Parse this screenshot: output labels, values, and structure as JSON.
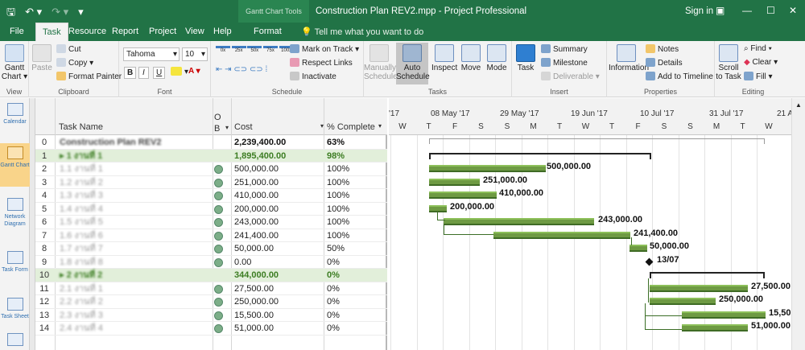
{
  "window": {
    "qat_icons": [
      "save-icon",
      "undo-icon",
      "redo-icon",
      "customize-icon"
    ],
    "tool_tab_context": "Gantt Chart Tools",
    "doc_title": "Construction Plan REV2.mpp  -  Project Professional",
    "signin": "Sign in",
    "controls": [
      "—",
      "☐",
      "✕"
    ]
  },
  "tabs": [
    "File",
    "Task",
    "Resource",
    "Report",
    "Project",
    "View",
    "Help",
    "Format"
  ],
  "active_tab": "Task",
  "tellme": "Tell me what you want to do",
  "ribbon": {
    "view": {
      "gantt_line1": "Gantt",
      "gantt_line2": "Chart ▾",
      "label": "View"
    },
    "clipboard": {
      "paste": "Paste",
      "cut": "Cut",
      "copy": "Copy ▾",
      "format_painter": "Format Painter",
      "label": "Clipboard"
    },
    "font": {
      "font_name": "Tahoma",
      "font_size": "10",
      "bold": "B",
      "italic": "I",
      "underline": "U",
      "label": "Font"
    },
    "schedule": {
      "pcts": [
        "0x",
        "25x",
        "50x",
        "75x",
        "100x"
      ],
      "mark_on_track": "Mark on Track",
      "respect_links": "Respect Links",
      "inactivate": "Inactivate",
      "label": "Schedule"
    },
    "tasks": {
      "manually": "Manually",
      "manually2": "Schedule",
      "auto": "Auto",
      "auto2": "Schedule",
      "inspect": "Inspect",
      "move": "Move",
      "mode": "Mode",
      "label": "Tasks"
    },
    "insert": {
      "task": "Task",
      "summary": "Summary",
      "milestone": "Milestone",
      "deliverable": "Deliverable",
      "label": "Insert"
    },
    "properties": {
      "information": "Information",
      "notes": "Notes",
      "details": "Details",
      "add_timeline": "Add to Timeline",
      "label": "Properties"
    },
    "editing": {
      "scroll": "Scroll",
      "scroll2": "to Task",
      "find": "Find ▾",
      "clear": "Clear ▾",
      "fill": "Fill ▾",
      "label": "Editing"
    }
  },
  "sidebar": [
    "Calendar",
    "Gantt Chart",
    "Network Diagram",
    "Task Form",
    "Task Sheet"
  ],
  "table": {
    "headers": {
      "task_name": "Task Name",
      "indicators_line1": "O",
      "indicators_line2": "B",
      "cost": "Cost",
      "pct": "% Complete"
    },
    "rows": [
      {
        "id": "0",
        "name": "Construction Plan REV2",
        "cost": "2,239,400.00",
        "pct": "63%",
        "kind": "proj",
        "ind": false
      },
      {
        "id": "1",
        "name": "▸ 1 งานที่ 1",
        "cost": "1,895,400.00",
        "pct": "98%",
        "kind": "summary",
        "ind": false
      },
      {
        "id": "2",
        "name": "1.1 งานที่ 1",
        "cost": "500,000.00",
        "pct": "100%",
        "kind": "task",
        "ind": true
      },
      {
        "id": "3",
        "name": "1.2 งานที่ 2",
        "cost": "251,000.00",
        "pct": "100%",
        "kind": "task",
        "ind": true
      },
      {
        "id": "4",
        "name": "1.3 งานที่ 3",
        "cost": "410,000.00",
        "pct": "100%",
        "kind": "task",
        "ind": true
      },
      {
        "id": "5",
        "name": "1.4 งานที่ 4",
        "cost": "200,000.00",
        "pct": "100%",
        "kind": "task",
        "ind": true
      },
      {
        "id": "6",
        "name": "1.5 งานที่ 5",
        "cost": "243,000.00",
        "pct": "100%",
        "kind": "task",
        "ind": true
      },
      {
        "id": "7",
        "name": "1.6 งานที่ 6",
        "cost": "241,400.00",
        "pct": "100%",
        "kind": "task",
        "ind": true
      },
      {
        "id": "8",
        "name": "1.7 งานที่ 7",
        "cost": "50,000.00",
        "pct": "50%",
        "kind": "task",
        "ind": true
      },
      {
        "id": "9",
        "name": "1.8 งานที่ 8",
        "cost": "0.00",
        "pct": "0%",
        "kind": "task",
        "ind": true
      },
      {
        "id": "10",
        "name": "▸ 2 งานที่ 2",
        "cost": "344,000.00",
        "pct": "0%",
        "kind": "summary",
        "ind": false
      },
      {
        "id": "11",
        "name": "2.1 งานที่ 1",
        "cost": "27,500.00",
        "pct": "0%",
        "kind": "task",
        "ind": true
      },
      {
        "id": "12",
        "name": "2.2 งานที่ 2",
        "cost": "250,000.00",
        "pct": "0%",
        "kind": "task",
        "ind": true
      },
      {
        "id": "13",
        "name": "2.3 งานที่ 3",
        "cost": "15,500.00",
        "pct": "0%",
        "kind": "task",
        "ind": true
      },
      {
        "id": "14",
        "name": "2.4 งานที่ 4",
        "cost": "51,000.00",
        "pct": "0%",
        "kind": "task",
        "ind": true
      }
    ]
  },
  "gantt": {
    "timescale_top": [
      "'17",
      "08 May '17",
      "29 May '17",
      "19 Jun '17",
      "10 Jul '17",
      "31 Jul '17",
      "21 A"
    ],
    "timescale_bottom": [
      "W",
      "T",
      "F",
      "S",
      "S",
      "M",
      "T",
      "W",
      "T",
      "F",
      "S",
      "S",
      "M",
      "T",
      "W"
    ],
    "bar_labels": [
      "500,000.00",
      "251,000.00",
      "410,000.00",
      "200,000.00",
      "243,000.00",
      "241,400.00",
      "50,000.00",
      "13/07",
      "27,500.00",
      "250,000.00",
      "15,50",
      "51,000.00"
    ]
  }
}
